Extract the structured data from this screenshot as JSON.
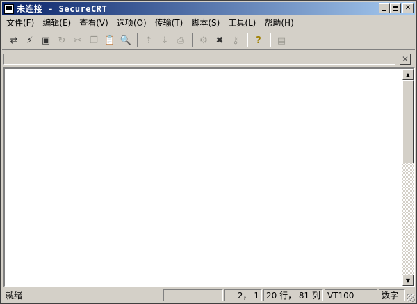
{
  "window": {
    "title": "未连接 - SecureCRT"
  },
  "menu": [
    "文件(F)",
    "编辑(E)",
    "查看(V)",
    "选项(O)",
    "传输(T)",
    "脚本(S)",
    "工具(L)",
    "帮助(H)"
  ],
  "toolbar": {
    "groups": [
      [
        "connect-icon",
        "quick-connect-icon",
        "connect-tab-icon",
        "reconnect-icon",
        "disconnect-icon",
        "copy-icon",
        "paste-icon",
        "find-icon"
      ],
      [
        "send-file-icon",
        "receive-file-icon",
        "print-icon"
      ],
      [
        "session-options-icon",
        "global-options-icon",
        "key-icon"
      ],
      [
        "help-icon"
      ],
      [
        "sftp-icon"
      ]
    ]
  },
  "status": {
    "ready": "就绪",
    "position": "2， 1",
    "size": "20 行， 81 列",
    "terminal": "VT100",
    "numlock": "数字"
  }
}
